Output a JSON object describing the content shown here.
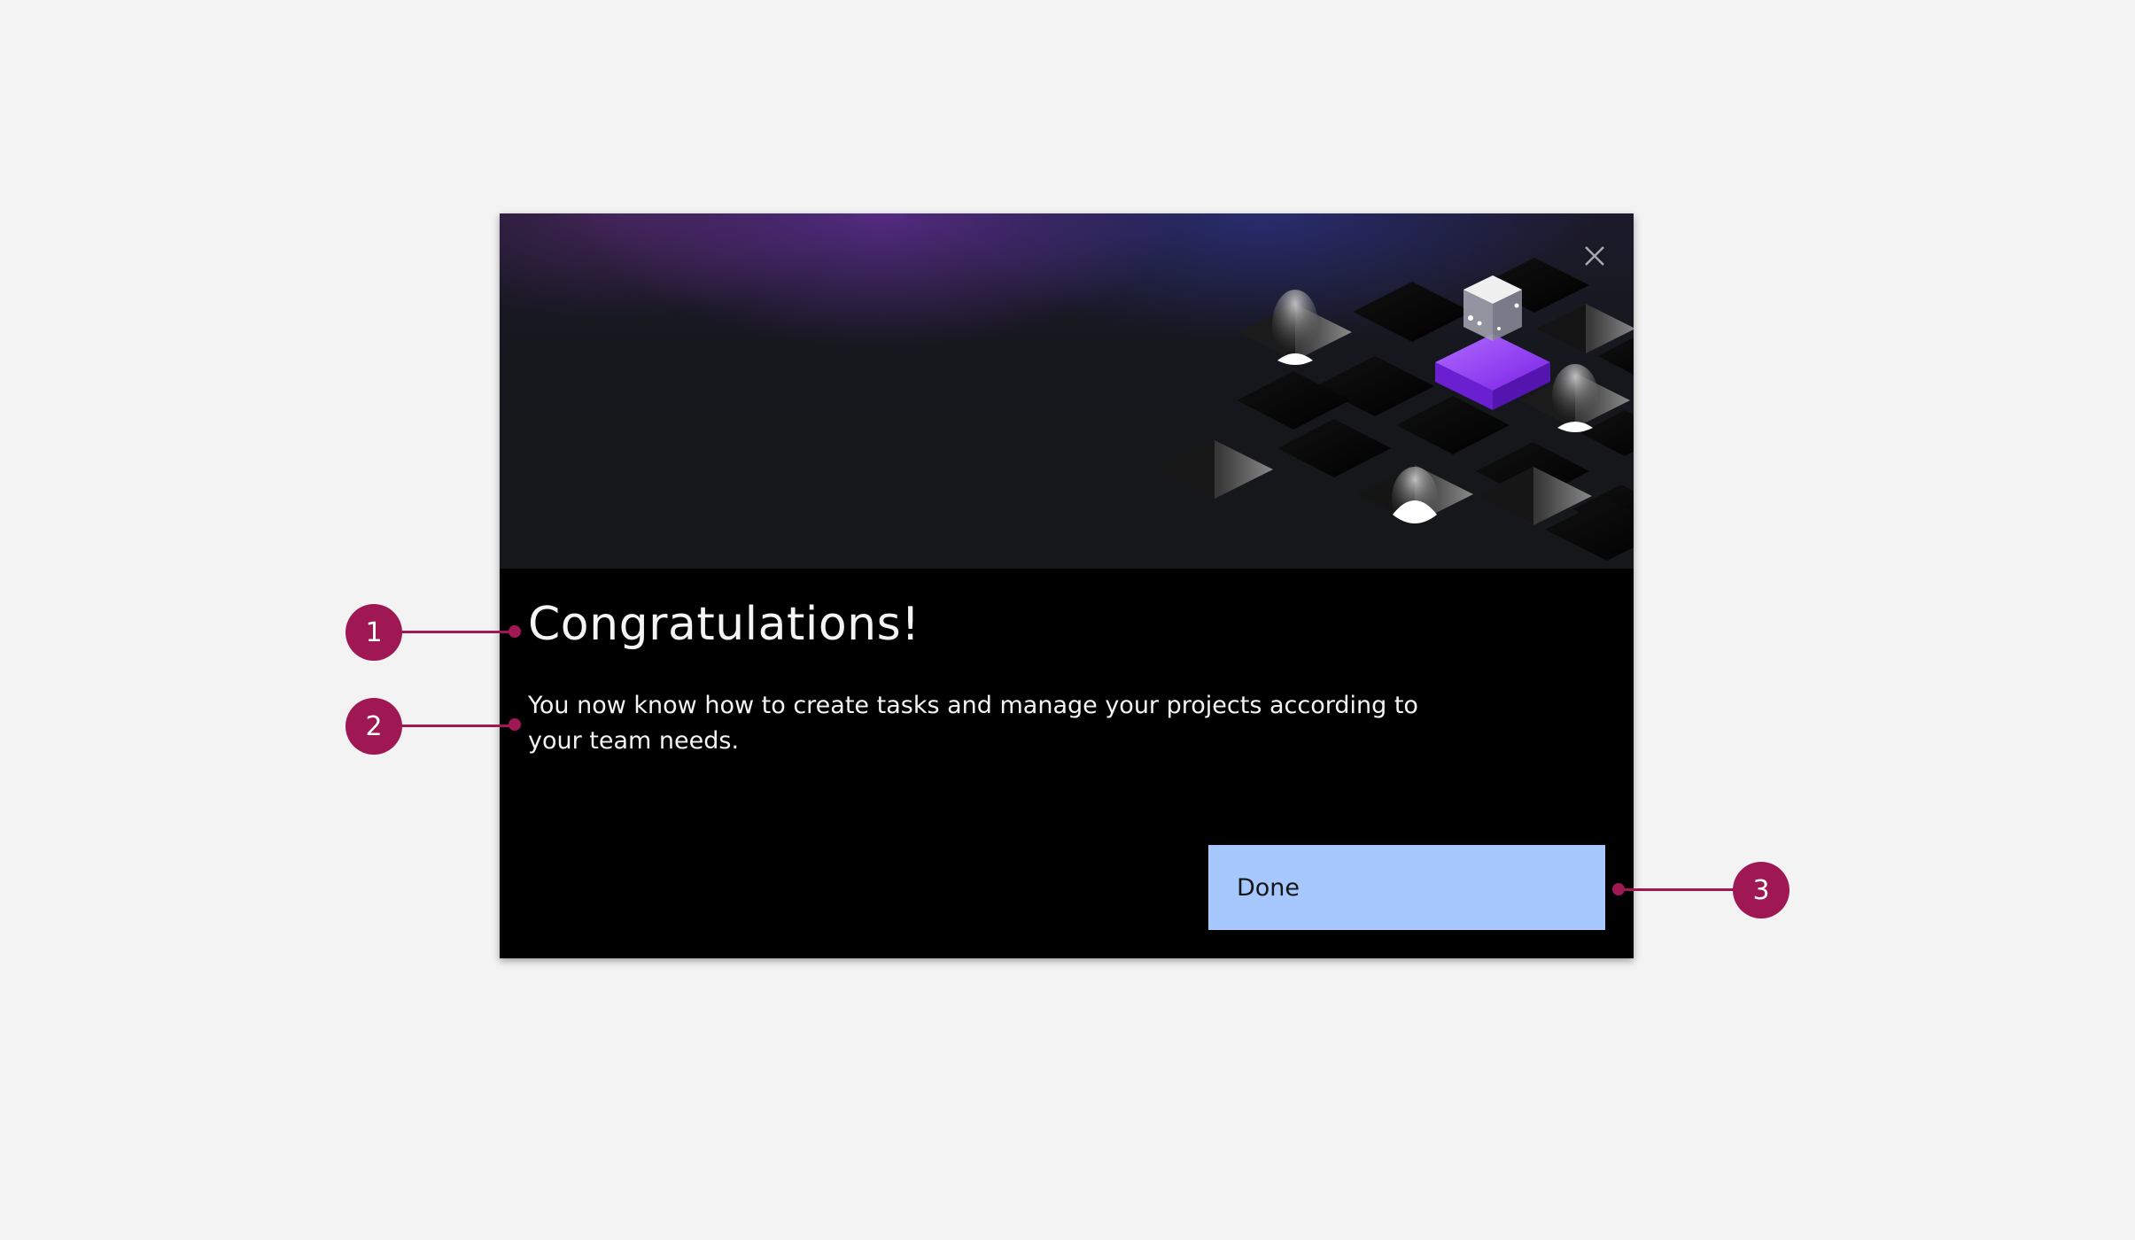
{
  "modal": {
    "title": "Congratulations!",
    "body": "You now know how to create tasks and manage your projects according to your team needs.",
    "primary_button_label": "Done",
    "close_icon": "close-icon",
    "illustration": "isometric-grid-illustration"
  },
  "annotations": [
    {
      "label": "1",
      "target": "modal-title"
    },
    {
      "label": "2",
      "target": "modal-body"
    },
    {
      "label": "3",
      "target": "done-button"
    }
  ],
  "colors": {
    "page_background": "#f3f3f3",
    "modal_background": "#000000",
    "primary_button": "#a6c8ff",
    "annotation": "#9f1853",
    "text": "#f4f4f4"
  }
}
